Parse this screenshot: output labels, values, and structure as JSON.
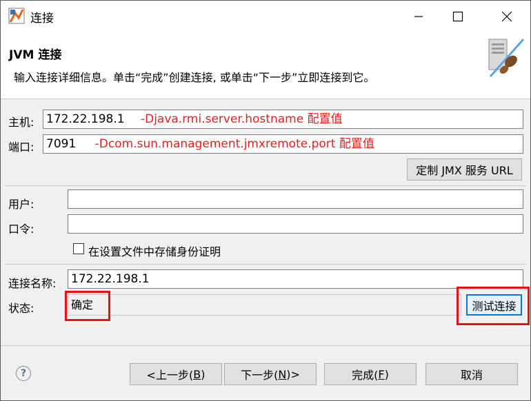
{
  "window": {
    "title": "连接"
  },
  "header": {
    "title": "JVM 连接",
    "description": "输入连接详细信息。单击“完成”创建连接, 或单击“下一步”立即连接到它。"
  },
  "host": {
    "label": "主机:",
    "value": "172.22.198.1",
    "hint": "-Djava.rmi.server.hostname 配置值"
  },
  "port": {
    "label": "端口:",
    "value": "7091",
    "hint": "-Dcom.sun.management.jmxremote.port 配置值"
  },
  "custom_jmx_button": "定制 JMX 服务 URL",
  "user": {
    "label": "用户:",
    "value": ""
  },
  "password": {
    "label": "口令:",
    "value": ""
  },
  "store_credentials": {
    "label": "在设置文件中存储身份证明",
    "checked": false
  },
  "connection_name": {
    "label": "连接名称:",
    "value": "172.22.198.1"
  },
  "status": {
    "label": "状态:",
    "value": "确定"
  },
  "test_connection_button": "测试连接",
  "footer": {
    "back": {
      "text": "<上一步(",
      "mnemonic": "B",
      "suffix": ")"
    },
    "next": {
      "text": "下一步(",
      "mnemonic": "N",
      "suffix": ")>"
    },
    "finish": {
      "text": "完成(",
      "mnemonic": "F",
      "suffix": ")"
    },
    "cancel": "取消"
  },
  "colors": {
    "annotation": "#e81010",
    "hint_text": "#e32020"
  }
}
